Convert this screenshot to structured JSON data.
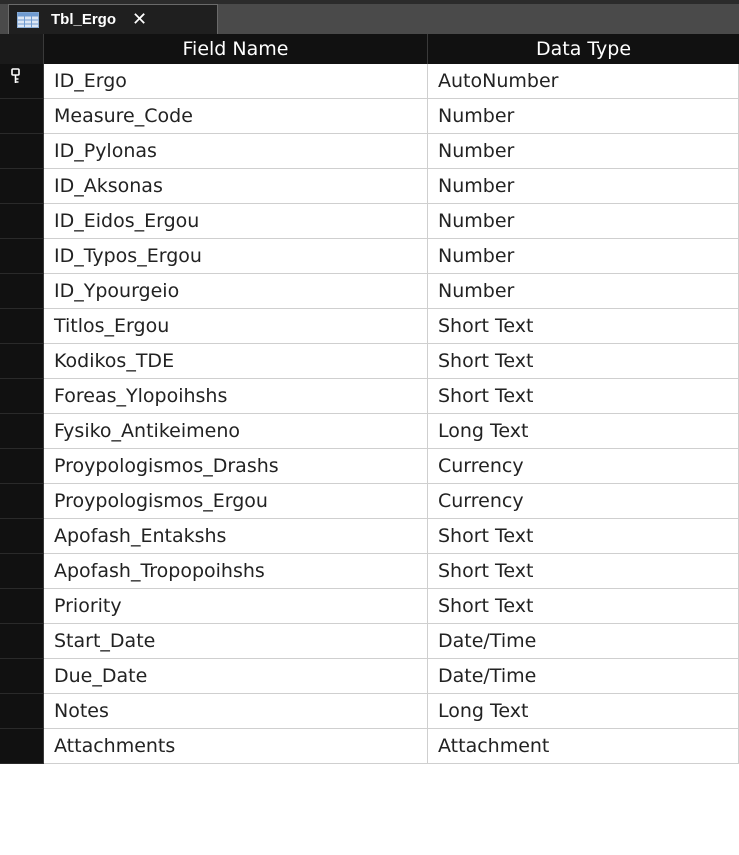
{
  "tab": {
    "title": "Tbl_Ergo",
    "close_glyph": "✕",
    "icon": "table-icon"
  },
  "columns": {
    "field_name": "Field Name",
    "data_type": "Data Type"
  },
  "rows": [
    {
      "field": "ID_Ergo",
      "type": "AutoNumber",
      "primary_key": true
    },
    {
      "field": "Measure_Code",
      "type": "Number"
    },
    {
      "field": "ID_Pylonas",
      "type": "Number"
    },
    {
      "field": "ID_Aksonas",
      "type": "Number"
    },
    {
      "field": "ID_Eidos_Ergou",
      "type": "Number"
    },
    {
      "field": "ID_Typos_Ergou",
      "type": "Number"
    },
    {
      "field": "ID_Ypourgeio",
      "type": "Number"
    },
    {
      "field": "Titlos_Ergou",
      "type": "Short Text"
    },
    {
      "field": "Kodikos_TDE",
      "type": "Short Text"
    },
    {
      "field": "Foreas_Ylopoihshs",
      "type": "Short Text"
    },
    {
      "field": "Fysiko_Antikeimeno",
      "type": "Long Text"
    },
    {
      "field": "Proypologismos_Drashs",
      "type": "Currency"
    },
    {
      "field": "Proypologismos_Ergou",
      "type": "Currency"
    },
    {
      "field": "Apofash_Entakshs",
      "type": "Short Text"
    },
    {
      "field": "Apofash_Tropopoihshs",
      "type": "Short Text"
    },
    {
      "field": "Priority",
      "type": "Short Text"
    },
    {
      "field": "Start_Date",
      "type": "Date/Time"
    },
    {
      "field": "Due_Date",
      "type": "Date/Time"
    },
    {
      "field": "Notes",
      "type": "Long Text"
    },
    {
      "field": "Attachments",
      "type": "Attachment"
    }
  ],
  "colors": {
    "tab_bg": "#1f1f1f",
    "header_bg": "#111111",
    "selector_bg": "#111111",
    "grid_line": "#cfcfcf"
  }
}
